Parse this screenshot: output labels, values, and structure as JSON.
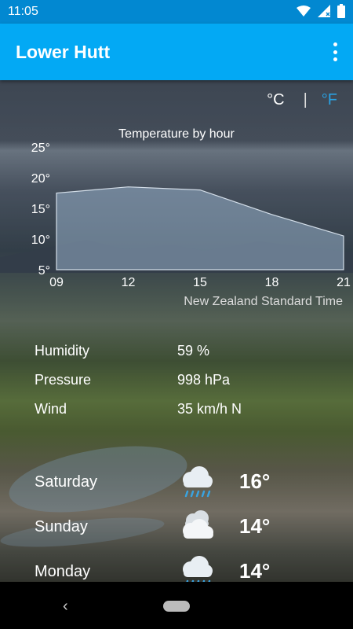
{
  "status_bar": {
    "time": "11:05"
  },
  "app_bar": {
    "title": "Lower Hutt"
  },
  "units": {
    "celsius": "°C",
    "separator": "|",
    "fahrenheit": "°F"
  },
  "chart_data": {
    "type": "area",
    "title": "Temperature by hour",
    "x": [
      "09",
      "12",
      "15",
      "18",
      "21"
    ],
    "y_tick_labels": [
      "25°",
      "20°",
      "15°",
      "10°",
      "5°"
    ],
    "ylim": [
      5,
      25
    ],
    "series": [
      {
        "x": [
          9,
          12,
          15,
          18,
          21
        ],
        "values": [
          17.5,
          18.5,
          18,
          14,
          10.5
        ]
      }
    ],
    "xlabel": "New Zealand Standard Time",
    "grid": false
  },
  "details": [
    {
      "label": "Humidity",
      "value": "59 %"
    },
    {
      "label": "Pressure",
      "value": "998 hPa"
    },
    {
      "label": "Wind",
      "value": "35 km/h N"
    }
  ],
  "forecast": [
    {
      "day": "Saturday",
      "temp": "16°",
      "icon": "rain-cloud-icon"
    },
    {
      "day": "Sunday",
      "temp": "14°",
      "icon": "cloudy-icon"
    },
    {
      "day": "Monday",
      "temp": "14°",
      "icon": "rain-cloud-icon"
    }
  ],
  "colors": {
    "status_bar": "#0288d1",
    "app_bar": "#03a9f4",
    "selected_unit": "#29a0e0"
  }
}
